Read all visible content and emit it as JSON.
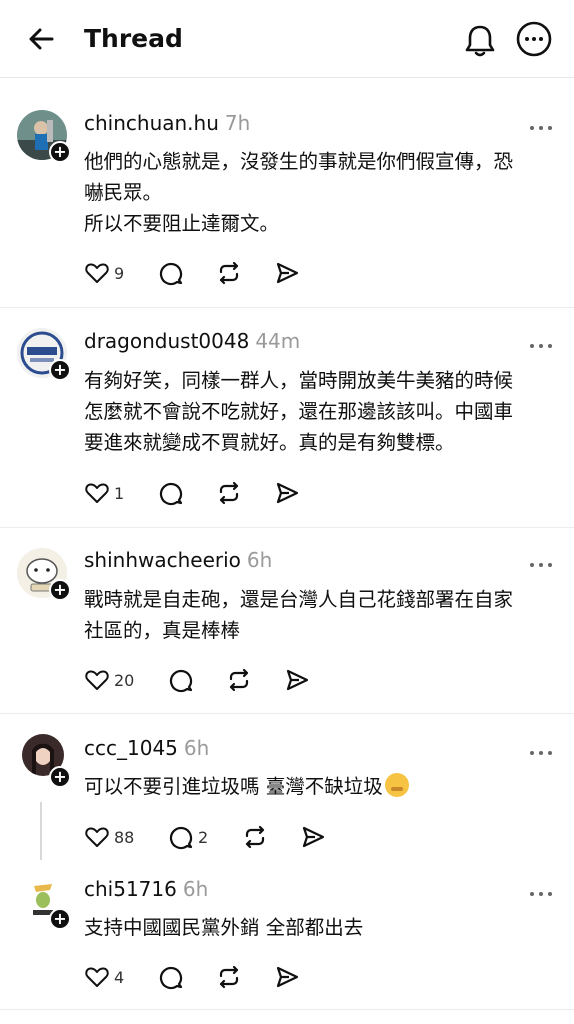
{
  "header": {
    "title": "Thread"
  },
  "posts": [
    {
      "username": "chinchuan.hu",
      "time": "7h",
      "lines": [
        "他們的心態就是，沒發生的事就是你們假宣傳，恐",
        "嚇民眾。",
        "所以不要阻止達爾文。"
      ],
      "likes": "9",
      "replies": ""
    },
    {
      "username": "dragondust0048",
      "time": "44m",
      "lines": [
        "有夠好笑，同樣一群人，當時開放美牛美豬的時候",
        "怎麼就不會說不吃就好，還在那邊該該叫。中國車",
        "要進來就變成不買就好。真的是有夠雙標。"
      ],
      "likes": "1",
      "replies": ""
    },
    {
      "username": "shinhwacheerio",
      "time": "6h",
      "lines": [
        "戰時就是自走砲，還是台灣人自己花錢部署在自家",
        "社區的，真是棒棒"
      ],
      "likes": "20",
      "replies": ""
    },
    {
      "username": "ccc_1045",
      "time": "6h",
      "lines": [
        "可以不要引進垃圾嗎 臺灣不缺垃圾"
      ],
      "likes": "88",
      "replies": "2"
    },
    {
      "username": "chi51716",
      "time": "6h",
      "lines": [
        "支持中國國民黨外銷 全部都出去"
      ],
      "likes": "4",
      "replies": ""
    }
  ],
  "icons": {
    "back": "arrow-left-icon",
    "bell": "bell-icon",
    "more": "more-circle-icon",
    "like": "heart-icon",
    "reply": "comment-icon",
    "repost": "repost-icon",
    "share": "send-icon",
    "post_menu": "more-dots-icon",
    "follow": "plus-icon"
  },
  "colors": {
    "text": "#101010",
    "muted": "#9a9a9a",
    "divider": "#ececec"
  }
}
